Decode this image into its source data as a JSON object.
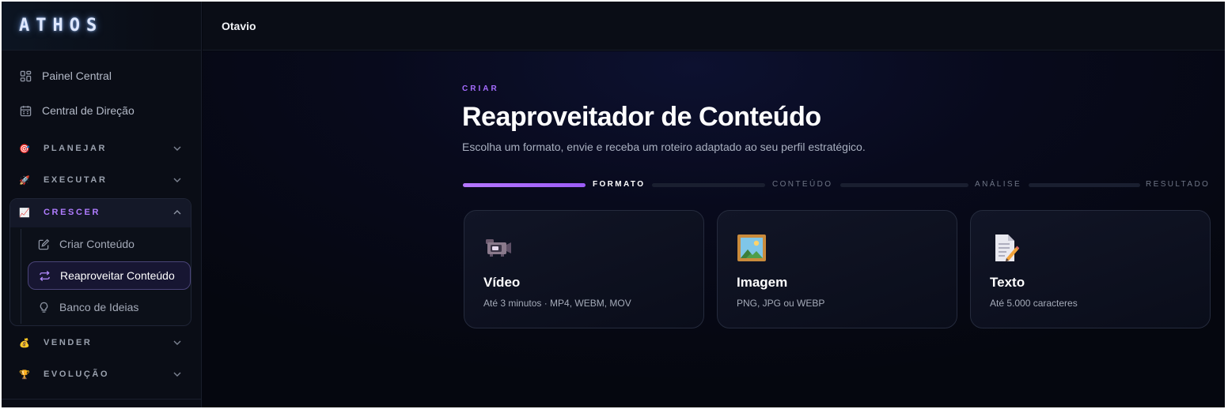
{
  "app": {
    "logo": "ATHOS"
  },
  "sidebar": {
    "items": [
      {
        "label": "Painel Central",
        "icon": "layout-grid-icon"
      },
      {
        "label": "Central de Direção",
        "icon": "calendar-icon"
      }
    ],
    "sections": [
      {
        "label": "PLANEJAR",
        "icon": "target-icon"
      },
      {
        "label": "EXECUTAR",
        "icon": "rocket-icon"
      },
      {
        "label": "CRESCER",
        "icon": "chart-up-icon",
        "expanded": true,
        "children": [
          {
            "label": "Criar Conteúdo",
            "icon": "edit-icon"
          },
          {
            "label": "Reaproveitar Conteúdo",
            "icon": "repeat-icon",
            "active": true
          },
          {
            "label": "Banco de Ideias",
            "icon": "lightbulb-icon"
          }
        ]
      },
      {
        "label": "VENDER",
        "icon": "money-bag-icon"
      },
      {
        "label": "EVOLUÇÃO",
        "icon": "trophy-icon"
      }
    ]
  },
  "topbar": {
    "user": "Otavio"
  },
  "page": {
    "eyebrow": "CRIAR",
    "title": "Reaproveitador de Conteúdo",
    "subtitle": "Escolha um formato, envie e receba um roteiro adaptado ao seu perfil estratégico."
  },
  "steps": [
    {
      "label": "FORMATO",
      "status": "current"
    },
    {
      "label": "CONTEÚDO",
      "status": "pending"
    },
    {
      "label": "ANÁLISE",
      "status": "pending"
    },
    {
      "label": "RESULTADO",
      "status": "pending"
    }
  ],
  "cards": [
    {
      "title": "Vídeo",
      "desc": "Até 3 minutos · MP4, WEBM, MOV",
      "icon": "video-camera-icon"
    },
    {
      "title": "Imagem",
      "desc": "PNG, JPG ou WEBP",
      "icon": "framed-picture-icon"
    },
    {
      "title": "Texto",
      "desc": "Até 5.000 caracteres",
      "icon": "memo-icon"
    }
  ],
  "colors": {
    "accent": "#a56cff",
    "background": "#05070f",
    "sidebar": "#0a0d16"
  }
}
